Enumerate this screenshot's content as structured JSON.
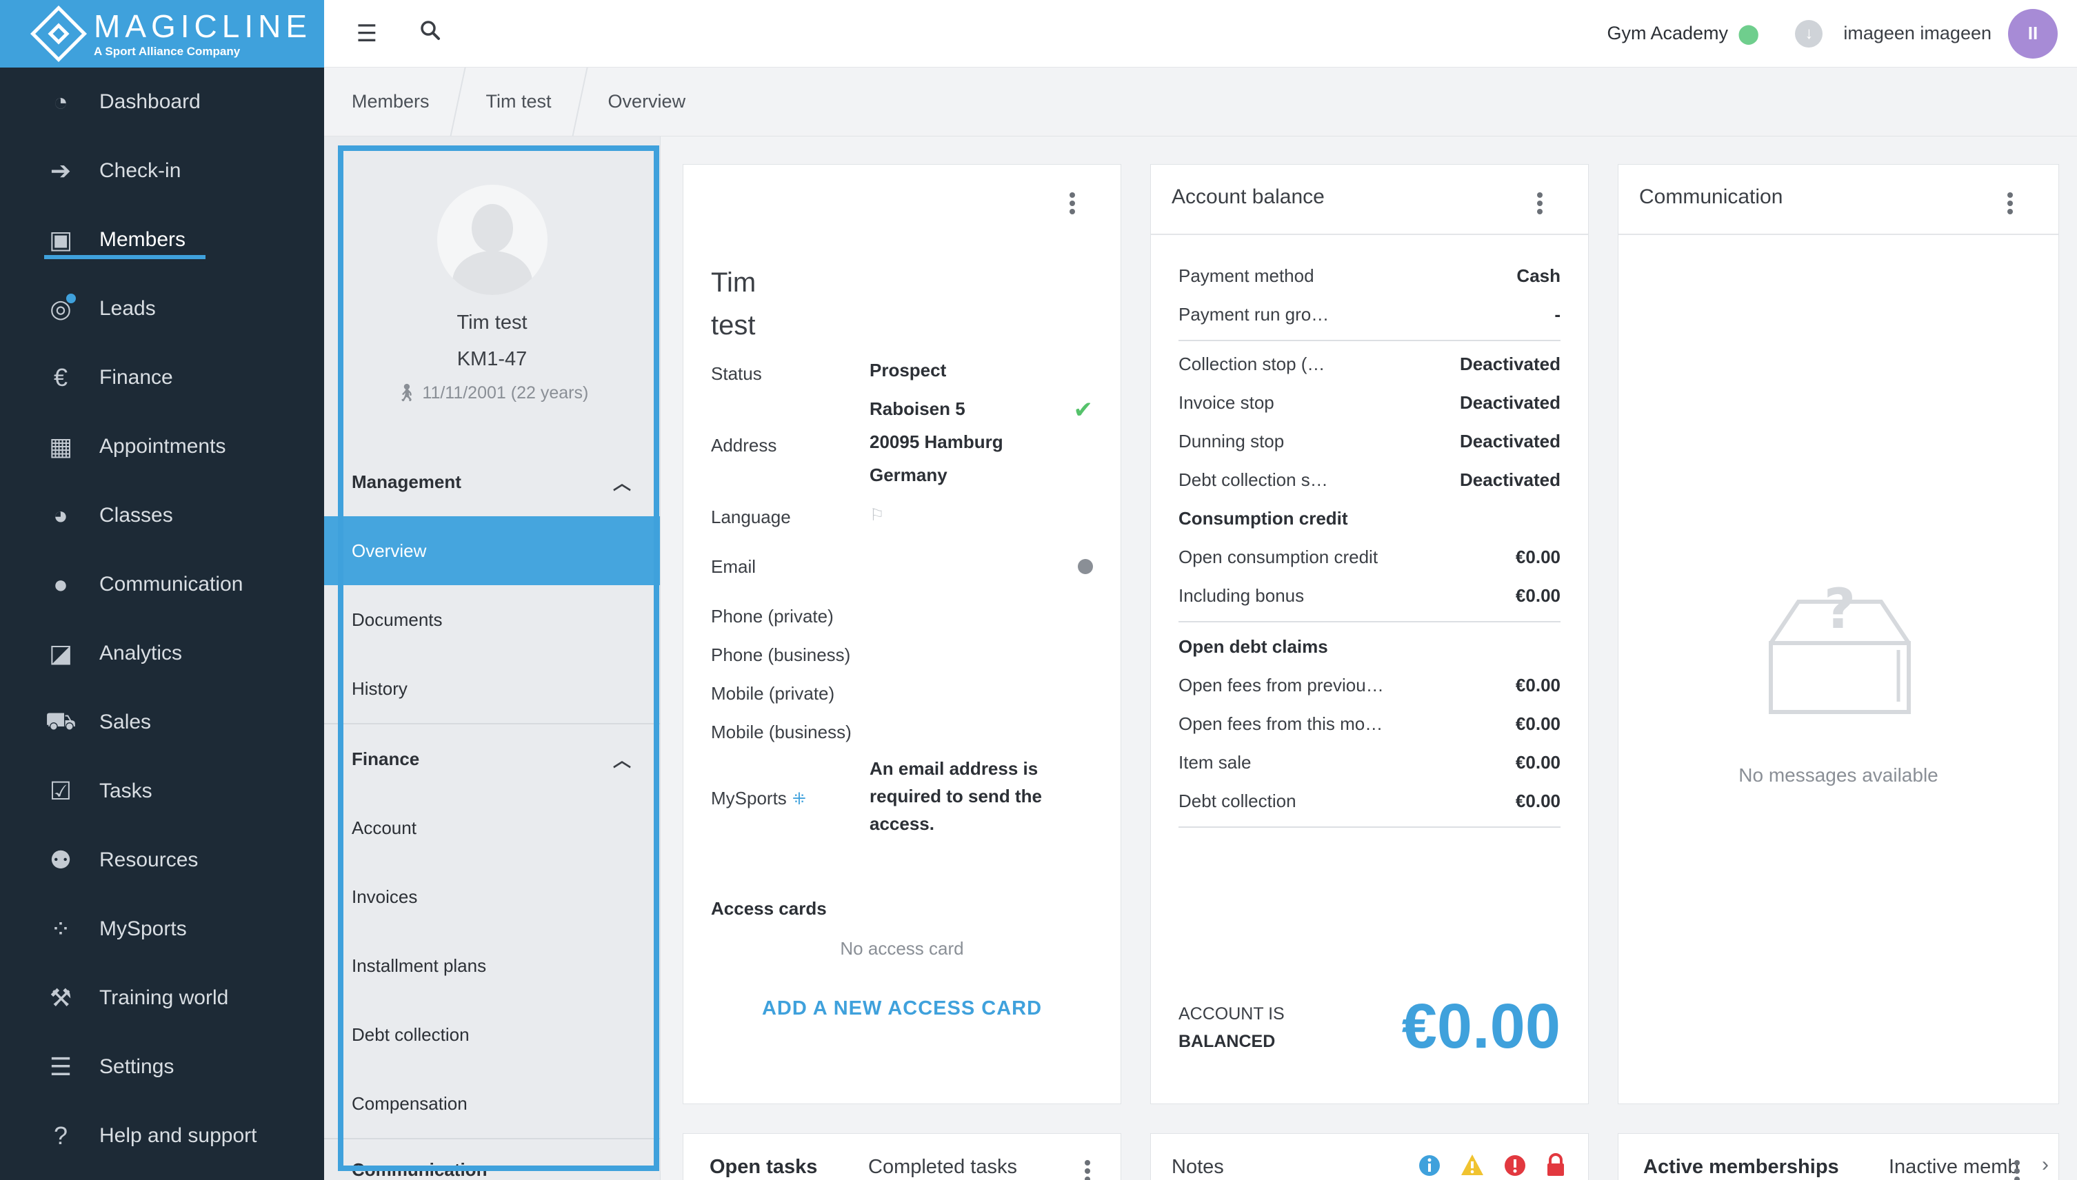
{
  "brand": {
    "name": "MAGICLINE",
    "tagline": "A Sport Alliance Company"
  },
  "nav": {
    "items": [
      {
        "label": "Dashboard",
        "icon": "dashboard-icon",
        "glyph": "◔"
      },
      {
        "label": "Check-in",
        "icon": "check-in-icon",
        "glyph": "➔"
      },
      {
        "label": "Members",
        "icon": "members-icon",
        "glyph": "▣",
        "active": true
      },
      {
        "label": "Leads",
        "icon": "leads-icon",
        "glyph": "◎"
      },
      {
        "label": "Finance",
        "icon": "finance-icon",
        "glyph": "€"
      },
      {
        "label": "Appointments",
        "icon": "calendar-icon",
        "glyph": "▦"
      },
      {
        "label": "Classes",
        "icon": "stopwatch-icon",
        "glyph": "◕"
      },
      {
        "label": "Communication",
        "icon": "chat-icon",
        "glyph": "●"
      },
      {
        "label": "Analytics",
        "icon": "chart-icon",
        "glyph": "◪"
      },
      {
        "label": "Sales",
        "icon": "cart-icon",
        "glyph": "⛟"
      },
      {
        "label": "Tasks",
        "icon": "checkbox-icon",
        "glyph": "☑"
      },
      {
        "label": "Resources",
        "icon": "people-icon",
        "glyph": "⚉"
      },
      {
        "label": "MySports",
        "icon": "mysports-icon",
        "glyph": "⁘"
      },
      {
        "label": "Training world",
        "icon": "dumbbell-icon",
        "glyph": "⚒"
      },
      {
        "label": "Settings",
        "icon": "sliders-icon",
        "glyph": "☰"
      },
      {
        "label": "Help and support",
        "icon": "help-icon",
        "glyph": "?"
      }
    ]
  },
  "topbar": {
    "studio": "Gym Academy",
    "user": "imageen imageen",
    "avatar_initials": "II"
  },
  "breadcrumb": [
    "Members",
    "Tim test",
    "Overview"
  ],
  "profile": {
    "name": "Tim test",
    "id": "KM1-47",
    "dob": "11/11/2001 (22 years)"
  },
  "side": {
    "management_title": "Management",
    "management_items": [
      "Overview",
      "Documents",
      "History"
    ],
    "finance_title": "Finance",
    "finance_items": [
      "Account",
      "Invoices",
      "Installment plans",
      "Debt collection",
      "Compensation"
    ],
    "next_section": "Communication"
  },
  "member_card": {
    "first_name": "Tim",
    "last_name": "test",
    "status_label": "Status",
    "status_value": "Prospect",
    "address_label": "Address",
    "address_lines": [
      "Raboisen 5",
      "20095 Hamburg",
      "Germany"
    ],
    "language_label": "Language",
    "email_label": "Email",
    "phone_private": "Phone (private)",
    "phone_business": "Phone (business)",
    "mobile_private": "Mobile (private)",
    "mobile_business": "Mobile (business)",
    "mysports_label": "MySports",
    "mysports_note": "An email address is required to send the access.",
    "access_cards_title": "Access cards",
    "no_access_card": "No access card",
    "add_access_card": "ADD A NEW ACCESS CARD"
  },
  "balance_card": {
    "title": "Account balance",
    "rows1": [
      {
        "label": "Payment method",
        "value": "Cash"
      },
      {
        "label": "Payment run gro…",
        "value": "-"
      }
    ],
    "rows2": [
      {
        "label": "Collection stop (…",
        "value": "Deactivated"
      },
      {
        "label": "Invoice stop",
        "value": "Deactivated"
      },
      {
        "label": "Dunning stop",
        "value": "Deactivated"
      },
      {
        "label": "Debt collection s…",
        "value": "Deactivated"
      }
    ],
    "consumption_title": "Consumption credit",
    "rows3": [
      {
        "label": "Open consumption credit",
        "value": "€0.00"
      },
      {
        "label": "Including bonus",
        "value": "€0.00"
      }
    ],
    "debt_title": "Open debt claims",
    "rows4": [
      {
        "label": "Open fees from previou…",
        "value": "€0.00"
      },
      {
        "label": "Open fees from this mo…",
        "value": "€0.00"
      },
      {
        "label": "Item sale",
        "value": "€0.00"
      },
      {
        "label": "Debt collection",
        "value": "€0.00"
      }
    ],
    "status_line1": "ACCOUNT IS",
    "status_line2": "BALANCED",
    "total": "€0.00"
  },
  "communication_card": {
    "title": "Communication",
    "empty": "No messages available"
  },
  "bottom": {
    "tasks_tab_open": "Open tasks",
    "tasks_tab_completed": "Completed tasks",
    "notes_title": "Notes",
    "memberships_active": "Active memberships",
    "memberships_inactive": "Inactive memb"
  },
  "colors": {
    "accent": "#3fa1dc",
    "nav_bg": "#1d2a36",
    "success": "#55c26b",
    "warning": "#f0c330",
    "danger": "#e2383f"
  }
}
